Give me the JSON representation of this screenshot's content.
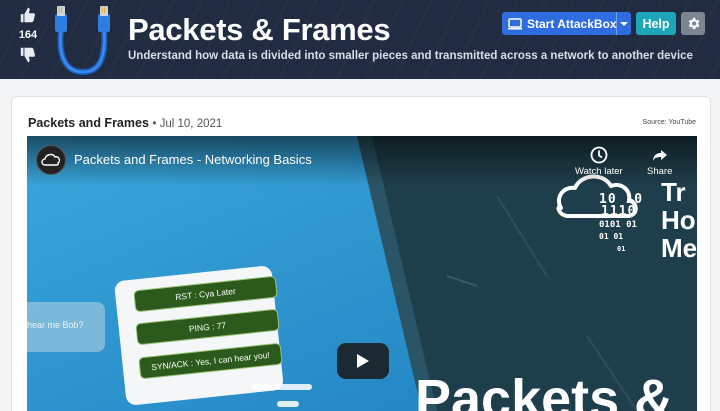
{
  "header": {
    "upvote_count": "164",
    "title": "Packets & Frames",
    "description": "Understand how data is divided into smaller pieces and transmitted across a network to another device",
    "buttons": {
      "attackbox_label": "Start AttackBox",
      "help_label": "Help"
    },
    "icons": [
      "thumbs-up-icon",
      "thumbs-down-icon",
      "ethernet-cable-icon",
      "monitor-icon",
      "chevron-down-icon",
      "gear-icon"
    ],
    "colors": {
      "background": "#212c42",
      "attackbox": "#2e6de0",
      "help": "#1da6b9",
      "settings": "#7d8590"
    }
  },
  "video_card": {
    "title": "Packets and Frames",
    "date_meta": "• Jul 10, 2021",
    "source": "Source: YouTube",
    "player": {
      "title": "Packets and Frames - Networking Basics",
      "watch_later_label": "Watch later",
      "share_label": "Share",
      "binary_lines": [
        "10  10",
        "1110",
        "0101  01",
        "01    01",
        "01"
      ],
      "brand_text": [
        "Tr",
        "Ho",
        "Me"
      ],
      "big_text": "Packets &",
      "bubbles": [
        "RST : Cya Later",
        "PING : 77",
        "SYN/ACK : Yes, I can hear you!"
      ],
      "side_bubble": "hear me Bob?"
    }
  }
}
